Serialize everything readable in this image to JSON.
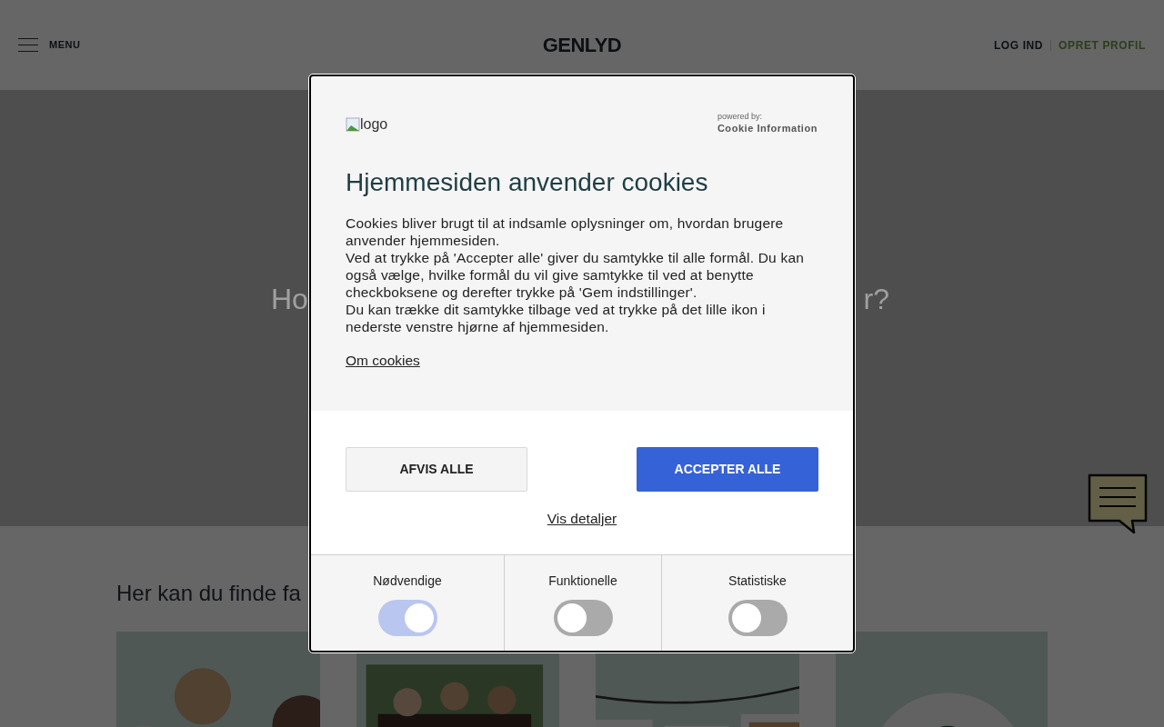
{
  "header": {
    "menu_label": "MENU",
    "logo": "GENLYD",
    "login": "LOG IND",
    "signup": "OPRET PROFIL"
  },
  "hero": {
    "title_left": "Ho",
    "title_right": "r?"
  },
  "section": {
    "heading": "Her kan du finde fa"
  },
  "cookie_dialog": {
    "logo_alt": "logo",
    "powered_by": "powered by:",
    "provider": "Cookie Information",
    "title": "Hjemmesiden anvender cookies",
    "paragraphs": [
      "Cookies bliver brugt til at indsamle oplysninger om, hvordan brugere anvender hjemmesiden.",
      "Ved at trykke på 'Accepter alle' giver du samtykke til alle formål. Du kan også vælge, hvilke formål du vil give samtykke til ved at benytte checkboksene og derefter trykke på 'Gem indstillinger'.",
      "Du kan trække dit samtykke tilbage ved at trykke på det lille ikon i nederste venstre hjørne af hjemmesiden."
    ],
    "about_link": "Om cookies",
    "reject_button": "AFVIS ALLE",
    "accept_button": "ACCEPTER ALLE",
    "details_link": "Vis detaljer",
    "categories": [
      {
        "label": "Nødvendige",
        "on": true,
        "disabled": true
      },
      {
        "label": "Funktionelle",
        "on": false,
        "disabled": false
      },
      {
        "label": "Statistiske",
        "on": false,
        "disabled": false
      }
    ]
  }
}
